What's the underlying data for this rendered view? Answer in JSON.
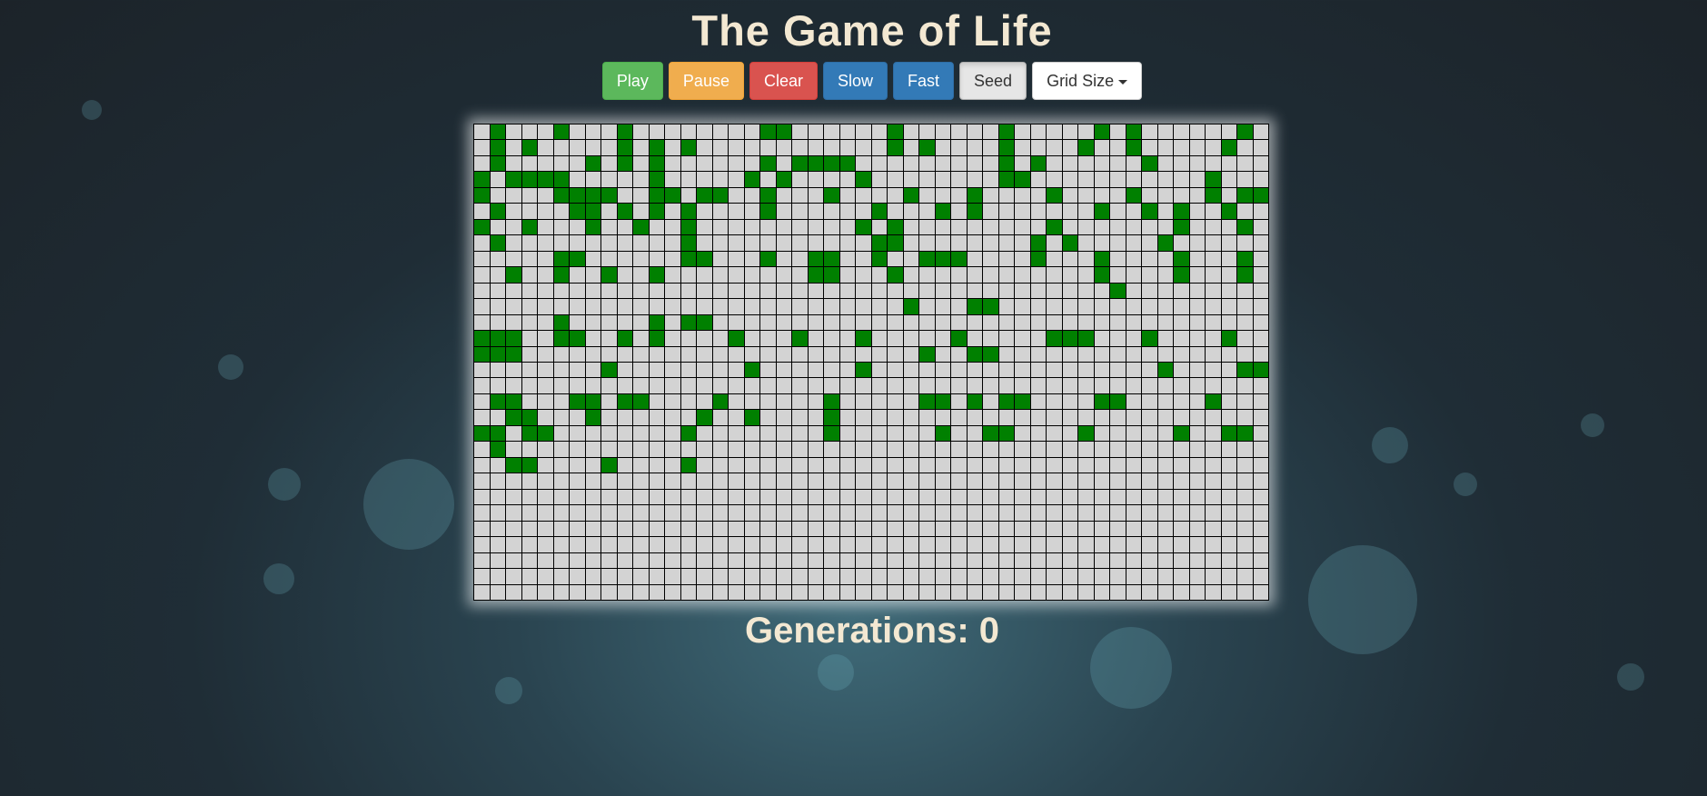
{
  "title": "The Game of Life",
  "buttons": {
    "play": "Play",
    "pause": "Pause",
    "clear": "Clear",
    "slow": "Slow",
    "fast": "Fast",
    "seed": "Seed",
    "grid_size": "Grid Size"
  },
  "generations": {
    "label": "Generations: 0",
    "count": 0
  },
  "board": {
    "columns": 50,
    "rows": 30,
    "alive_color": "#008000",
    "dead_color": "#d3d3d3",
    "rows_data": [
      "01000100010000000011000000100000010000010100000010",
      "01010000010101000000000000101000010000100100000100",
      "01000001010100000010111100000000010100000010000000",
      "10111100000100000101000010000000011000000000001000",
      "10000111100110110010001000010001000010000100001011",
      "01000011010101000010000001000101000000010010100100",
      "10010001001001000000000010100000000010000000100010",
      "01000000000001000000000001100000000101000001000000",
      "00000110000001100010011001001110000100010000100010",
      "00100100100100000000011000100000000000010000100010",
      "00000000000000000000000000000000000000001000000000",
      "00000000000000000000000000010001100000000000000000",
      "00000100000101100000000000000000000000000000000000",
      "11100110010100001000100010000010000011100010000100",
      "11100000000000000000000000001001100000000000000000",
      "00000000100000000100000010000000000000000001000011",
      "00000000000000000000000000000000000000000000000000",
      "01100011011000010000001000001101011000011000001000",
      "00110001000000100100001000000000000000000000000000",
      "11011000000001000000001000000100110000100000100110",
      "01000000000000000000000000000000000000000000000000",
      "00110000100001000000000000000000000000000000000000",
      "00000000000000000000000000000000000000000000000000",
      "00000000000000000000000000000000000000000000000000",
      "00000000000000000000000000000000000000000000000000",
      "00000000000000000000000000000000000000000000000000",
      "00000000000000000000000000000000000000000000000000",
      "00000000000000000000000000000000000000000000000000",
      "00000000000000000000000000000000000000000000000000",
      "00000000000000000000000000000000000000000000000000"
    ]
  }
}
